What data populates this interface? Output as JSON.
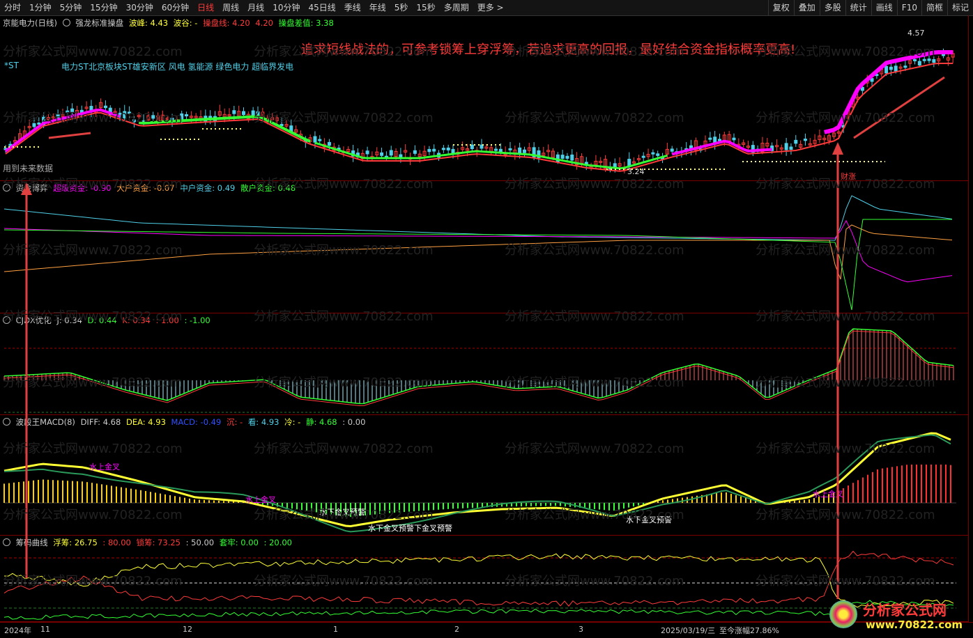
{
  "toolbar": {
    "periods": [
      "分时",
      "1分钟",
      "5分钟",
      "15分钟",
      "30分钟",
      "60分钟",
      "日线",
      "周线",
      "月线",
      "10分钟",
      "45日线",
      "季线",
      "年线",
      "5秒",
      "15秒",
      "多周期",
      "更多 >"
    ],
    "active_period": "日线",
    "tools": [
      "复权",
      "叠加",
      "多股",
      "统计",
      "画线",
      "F10",
      "简框",
      "标记"
    ]
  },
  "main": {
    "stock": "京能电力(日线)",
    "indicator": "强龙标准操盘",
    "peak_label": "波峰: 4.43",
    "valley_label": "波谷: -",
    "line_label": "操盘线: 4.20",
    "line_value": "4.20",
    "diff_label": "操盘差值: 3.38",
    "st_tag": "*ST",
    "concepts": "电力ST北京板块ST雄安新区 风电 氢能源 绿色电力 超临界发电",
    "annotation": "追求短线战法的，可参考锁筹上穿浮筹，若追求更高的回报，最好结合资金指标概率更高!",
    "future_note": "用到未来数据",
    "high_label": "4.57",
    "low_label": "3.24",
    "cai_label": "财涨"
  },
  "fund": {
    "name": "资金博弈",
    "super": "超级资金: -0.90",
    "big": "大户资金: -0.07",
    "mid": "中户资金: 0.49",
    "retail": "散户资金: 0.48"
  },
  "cjdx": {
    "name": "CJDX优化",
    "j": "J: 0.34",
    "d": "D: 0.44",
    "k": "K: 0.34",
    "v1": ": 1.00",
    "v2": ": -1.00"
  },
  "macd": {
    "name": "波段王MACD(8)",
    "diff": "DIFF: 4.68",
    "dea": "DEA: 4.93",
    "macd": "MACD: -0.49",
    "chen": "沉: -",
    "kan": "看: 4.93",
    "leng": "冷: -",
    "jing": "静: 4.68",
    "zero": ": 0.00",
    "signal1": "水上金叉",
    "signal2": "水上金叉",
    "signal3": "水下金叉预警",
    "signal4": "水下金叉预警下金叉预警",
    "signal5": "水下金叉预警",
    "signal6": "水上金叉"
  },
  "chip": {
    "name": "筹码曲线",
    "float": "浮筹: 26.75",
    "v80": ": 80.00",
    "lock": "锁筹: 73.25",
    "v50": ": 50.00",
    "trap": "套牢: 0.00",
    "v20": ": 20.00"
  },
  "axis": {
    "labels": [
      "2024年",
      "11",
      "12",
      "1",
      "2",
      "3"
    ],
    "date": "2025/03/19/三",
    "gain": "至今涨幅27.86%"
  },
  "watermark": "分析家公式网www.70822.com",
  "logo": {
    "text": "分析家公式网",
    "url": "www.70822.com"
  },
  "colors": {
    "up": "#ff3b3b",
    "down": "#4fd0e8",
    "pink": "#ff00ff",
    "yellow": "#ffff33",
    "green": "#33ff33"
  }
}
